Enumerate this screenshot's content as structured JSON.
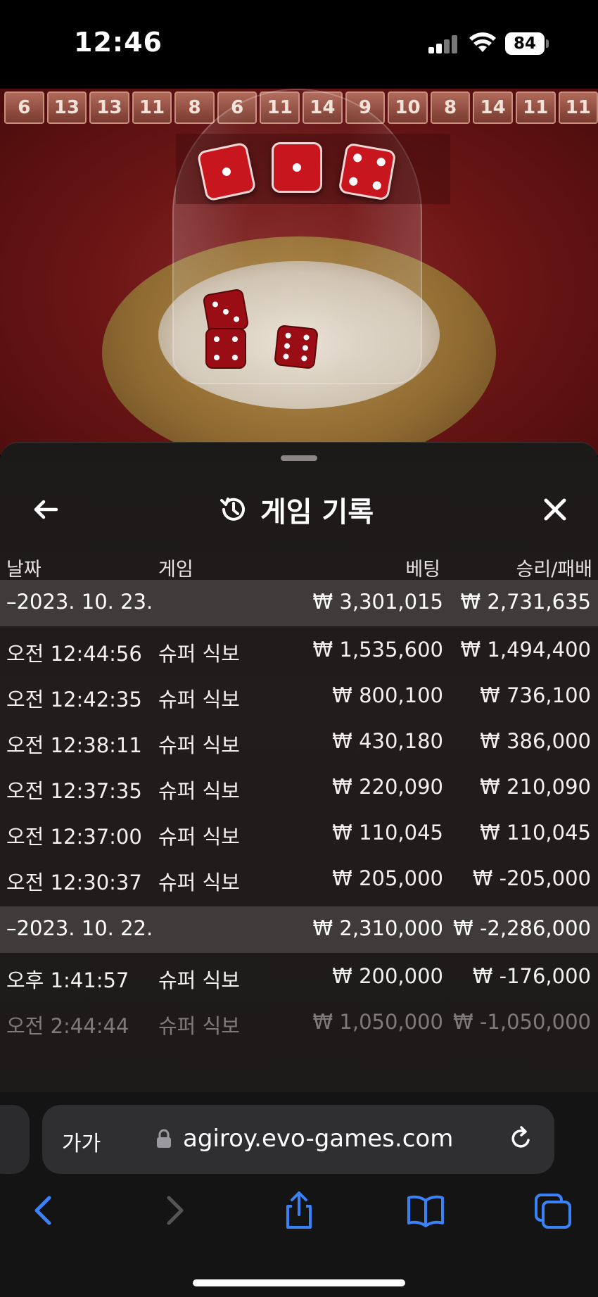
{
  "status": {
    "time": "12:46",
    "battery": "84"
  },
  "history": [
    "6",
    "13",
    "13",
    "11",
    "8",
    "6",
    "11",
    "14",
    "9",
    "10",
    "8",
    "14",
    "11",
    "11"
  ],
  "sheet": {
    "title": "게임 기록",
    "columns": {
      "date": "날짜",
      "game": "게임",
      "bet": "베팅",
      "win_loss": "승리/패배"
    },
    "groups": [
      {
        "date": "–2023. 10. 23.",
        "bet_total": "₩ 3,301,015",
        "win_total": "₩ 2,731,635",
        "rows": [
          {
            "time": "오전 12:44:56",
            "game": "슈퍼 식보",
            "bet": "₩ 1,535,600",
            "win": "₩ 1,494,400"
          },
          {
            "time": "오전 12:42:35",
            "game": "슈퍼 식보",
            "bet": "₩ 800,100",
            "win": "₩ 736,100"
          },
          {
            "time": "오전 12:38:11",
            "game": "슈퍼 식보",
            "bet": "₩ 430,180",
            "win": "₩ 386,000"
          },
          {
            "time": "오전 12:37:35",
            "game": "슈퍼 식보",
            "bet": "₩ 220,090",
            "win": "₩ 210,090"
          },
          {
            "time": "오전 12:37:00",
            "game": "슈퍼 식보",
            "bet": "₩ 110,045",
            "win": "₩ 110,045"
          },
          {
            "time": "오전 12:30:37",
            "game": "슈퍼 식보",
            "bet": "₩ 205,000",
            "win": "₩ -205,000"
          }
        ]
      },
      {
        "date": "–2023. 10. 22.",
        "bet_total": "₩ 2,310,000",
        "win_total": "₩ -2,286,000",
        "rows": [
          {
            "time": "오후 1:41:57",
            "game": "슈퍼 식보",
            "bet": "₩ 200,000",
            "win": "₩ -176,000"
          },
          {
            "time": "오전 2:44:44",
            "game": "슈퍼 식보",
            "bet": "₩ 1,050,000",
            "win": "₩ -1,050,000"
          }
        ]
      }
    ]
  },
  "browser": {
    "text_size_label": "가가",
    "url": "agiroy.evo-games.com"
  },
  "colors": {
    "accent_blue": "#3a82f7",
    "table_red": "#6e1616",
    "sheet_bg": "#1f1b1b"
  }
}
